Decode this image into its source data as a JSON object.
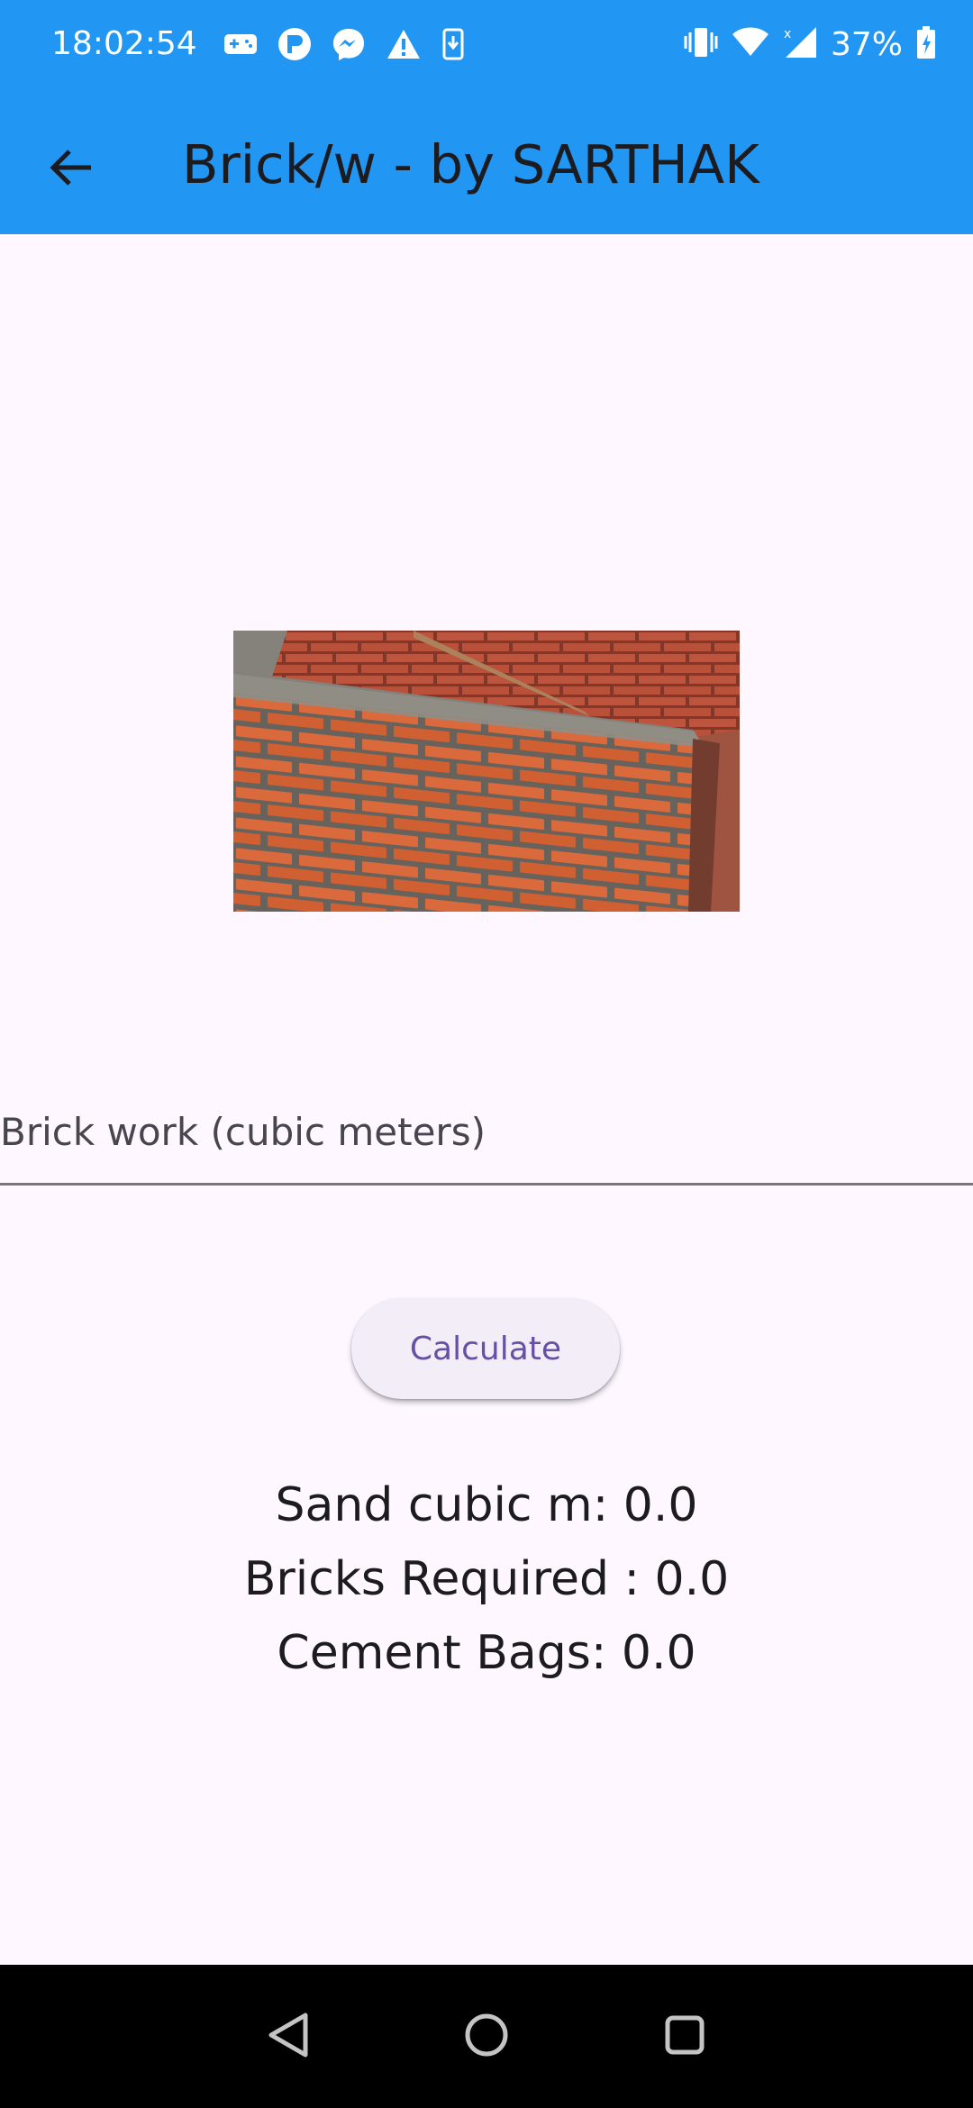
{
  "status_bar": {
    "time": "18:02:54",
    "battery": "37%",
    "left_icons": [
      "gamepad-icon",
      "p-badge-icon",
      "messenger-icon",
      "warning-icon",
      "download-icon"
    ],
    "right_icons": [
      "vibrate-icon",
      "wifi-icon",
      "signal-icon",
      "battery-icon"
    ]
  },
  "app_bar": {
    "title": "Brick/w - by SARTHAK",
    "back_icon": "arrow-back-icon",
    "color": "#2196f3"
  },
  "image": {
    "subject": "brick-wall-photo"
  },
  "input": {
    "placeholder": "Brick work (cubic meters)",
    "value": ""
  },
  "button": {
    "label": "Calculate"
  },
  "results": {
    "sand": "Sand cubic m: 0.0",
    "bricks": "Bricks Required : 0.0",
    "cement": "Cement Bags: 0.0"
  },
  "nav_bar": {
    "icons": [
      "back-triangle-icon",
      "home-circle-icon",
      "recents-square-icon"
    ]
  },
  "colors": {
    "accent": "#2196f3",
    "background": "#fef7ff",
    "button_text": "#6750a4"
  }
}
